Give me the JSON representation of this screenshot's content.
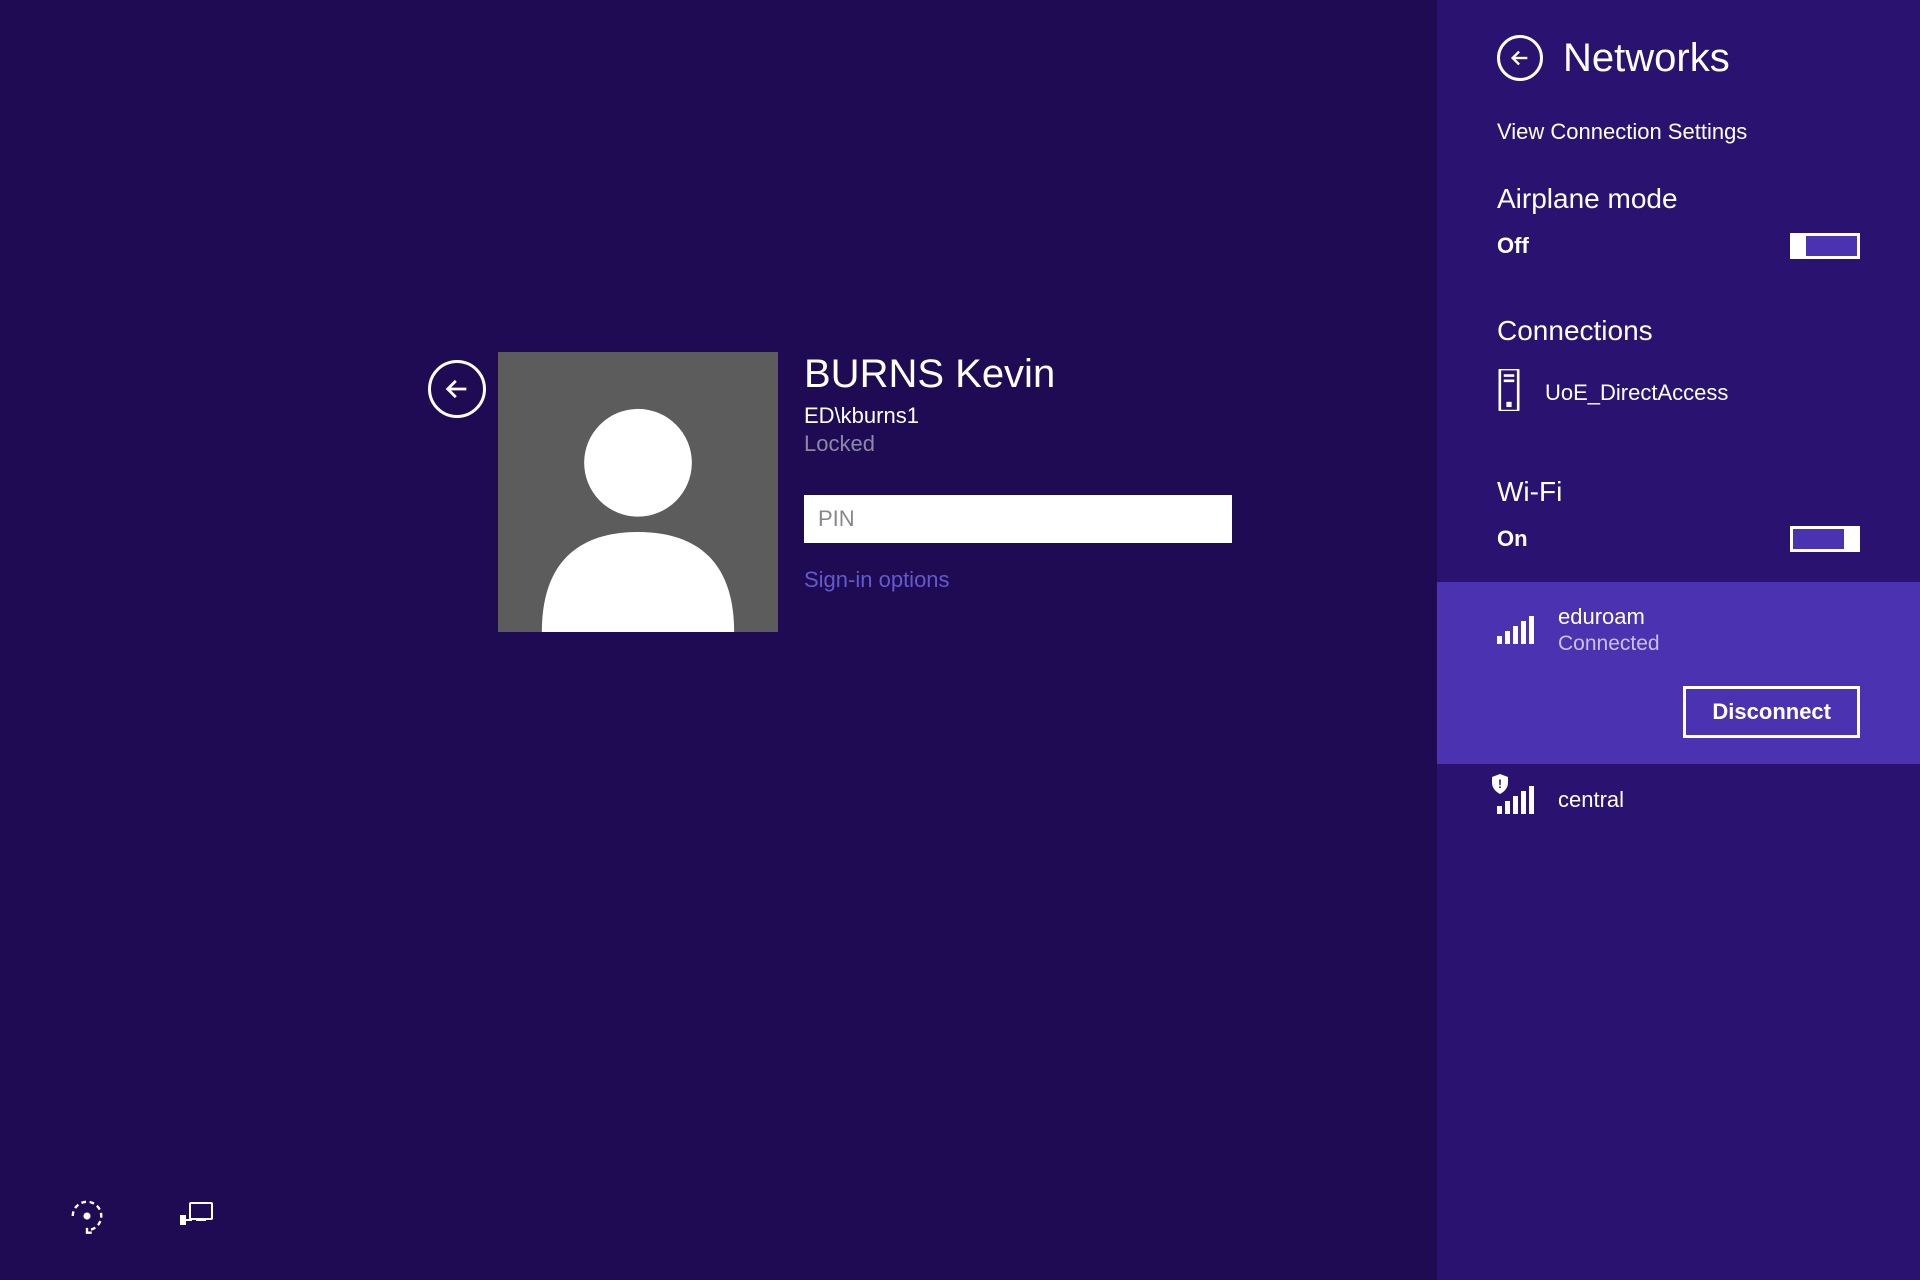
{
  "login": {
    "display_name": "BURNS Kevin",
    "userid": "ED\\kburns1",
    "status": "Locked",
    "pin_placeholder": "PIN",
    "signin_options": "Sign-in options"
  },
  "panel": {
    "title": "Networks",
    "view_settings": "View Connection Settings",
    "airplane_section": "Airplane mode",
    "airplane_state": "Off",
    "connections_section": "Connections",
    "connections": [
      {
        "name": "UoE_DirectAccess"
      }
    ],
    "wifi_section": "Wi-Fi",
    "wifi_state": "On",
    "wifi": [
      {
        "name": "eduroam",
        "status": "Connected",
        "selected": true,
        "secured": false
      },
      {
        "name": "central",
        "status": "",
        "selected": false,
        "secured": true
      }
    ],
    "disconnect_label": "Disconnect"
  }
}
